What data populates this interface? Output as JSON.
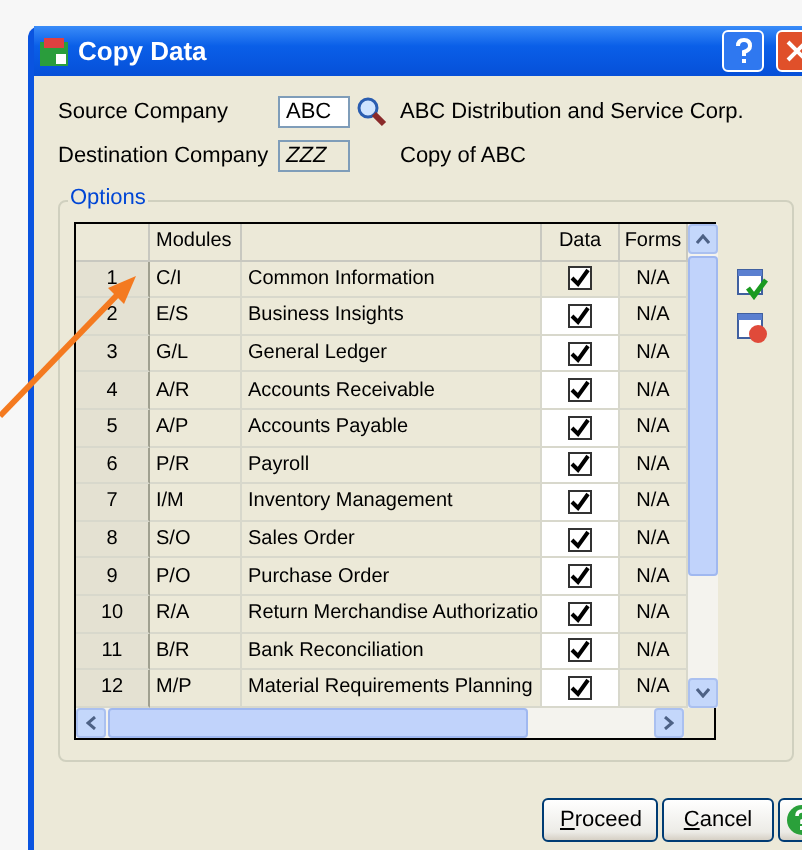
{
  "window": {
    "title": "Copy Data"
  },
  "source_company": {
    "label": "Source Company",
    "value": "ABC",
    "name": "ABC Distribution and Service Corp."
  },
  "destination_company": {
    "label": "Destination Company",
    "value": "ZZZ",
    "name": "Copy of ABC"
  },
  "options": {
    "title": "Options",
    "table": {
      "columns": [
        "Modules",
        "Data",
        "Forms"
      ],
      "rows": [
        {
          "number": "1",
          "module": "C/I",
          "name": "Common Information",
          "data": true,
          "forms": "N/A",
          "selected": true
        },
        {
          "number": "2",
          "module": "E/S",
          "name": "Business Insights",
          "data": true,
          "forms": "N/A",
          "selected": false
        },
        {
          "number": "3",
          "module": "G/L",
          "name": "General Ledger",
          "data": true,
          "forms": "N/A",
          "selected": false
        },
        {
          "number": "4",
          "module": "A/R",
          "name": "Accounts Receivable",
          "data": true,
          "forms": "N/A",
          "selected": false
        },
        {
          "number": "5",
          "module": "A/P",
          "name": "Accounts Payable",
          "data": true,
          "forms": "N/A",
          "selected": false
        },
        {
          "number": "6",
          "module": "P/R",
          "name": "Payroll",
          "data": true,
          "forms": "N/A",
          "selected": false
        },
        {
          "number": "7",
          "module": "I/M",
          "name": "Inventory Management",
          "data": true,
          "forms": "N/A",
          "selected": false
        },
        {
          "number": "8",
          "module": "S/O",
          "name": "Sales Order",
          "data": true,
          "forms": "N/A",
          "selected": false
        },
        {
          "number": "9",
          "module": "P/O",
          "name": "Purchase Order",
          "data": true,
          "forms": "N/A",
          "selected": false
        },
        {
          "number": "10",
          "module": "R/A",
          "name": "Return Merchandise Authorizatio",
          "data": true,
          "forms": "N/A",
          "selected": false
        },
        {
          "number": "11",
          "module": "B/R",
          "name": "Bank Reconciliation",
          "data": true,
          "forms": "N/A",
          "selected": false
        },
        {
          "number": "12",
          "module": "M/P",
          "name": "Material Requirements Planning",
          "data": true,
          "forms": "N/A",
          "selected": false
        }
      ]
    }
  },
  "buttons": [
    "Proceed",
    "Cancel"
  ]
}
